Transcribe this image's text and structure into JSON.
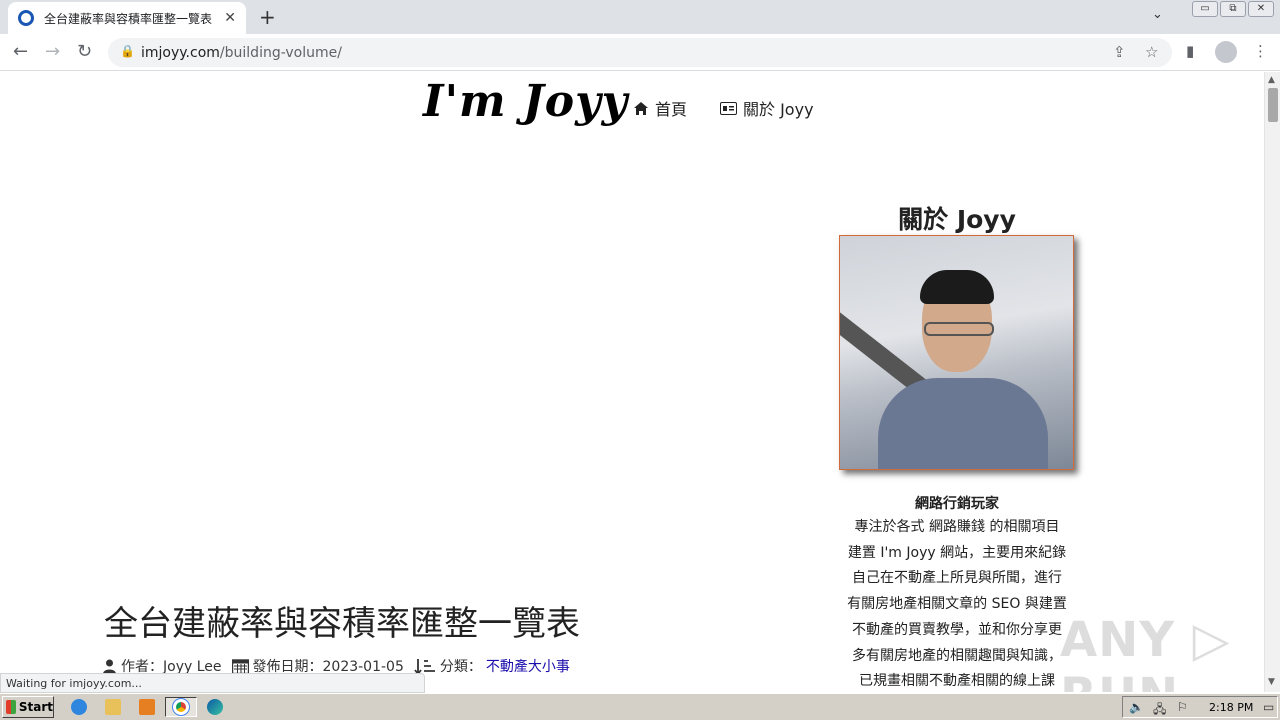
{
  "browser": {
    "tab_title": "全台建蔽率與容積率匯整一覽表 - I'm Joyy",
    "tab_close": "✕",
    "new_tab": "+",
    "tab_menu": "⌄",
    "window_buttons": [
      "▭",
      "⧉",
      "✕"
    ],
    "nav": {
      "back": "←",
      "forward": "→",
      "reload": "↻"
    },
    "url_host": "imjoyy.com",
    "url_path": "/building-volume/",
    "lock_icon": "🔒",
    "share_icon": "⇪",
    "star_icon": "☆",
    "sidepanel_icon": "▮",
    "menu_icon": "⋮",
    "status": "Waiting for imjoyy.com..."
  },
  "site": {
    "logo": "I'm Joyy",
    "nav_home": "首頁",
    "nav_about": "關於 Joyy"
  },
  "sidebar": {
    "title": "關於 Joyy",
    "subtitle": "網路行銷玩家",
    "lines": [
      "專注於各式 網路賺錢 的相關項目",
      "建置 I'm Joyy 網站，主要用來紀錄",
      "自己在不動產上所見與所聞，進行",
      "有關房地產相關文章的 SEO 與建置",
      "不動產的買賣教學，並和你分享更",
      "多有關房地產的相關趣聞與知識，",
      "已規畫相關不動產相關的線上課"
    ]
  },
  "article": {
    "title": "全台建蔽率與容積率匯整一覽表",
    "author_label": "作者：Joyy Lee",
    "date_label": "發佈日期：2023-01-05",
    "category_label": "分類：",
    "category_value": "不動產大小事"
  },
  "watermark": "ANY ▷ RUN",
  "taskbar": {
    "start": "Start",
    "clock": "2:18 PM"
  },
  "colors": {
    "photo_border": "#d36a3a",
    "link": "#1a0dab",
    "tabstrip": "#dee1e6",
    "taskbar": "#d4d0c8"
  }
}
